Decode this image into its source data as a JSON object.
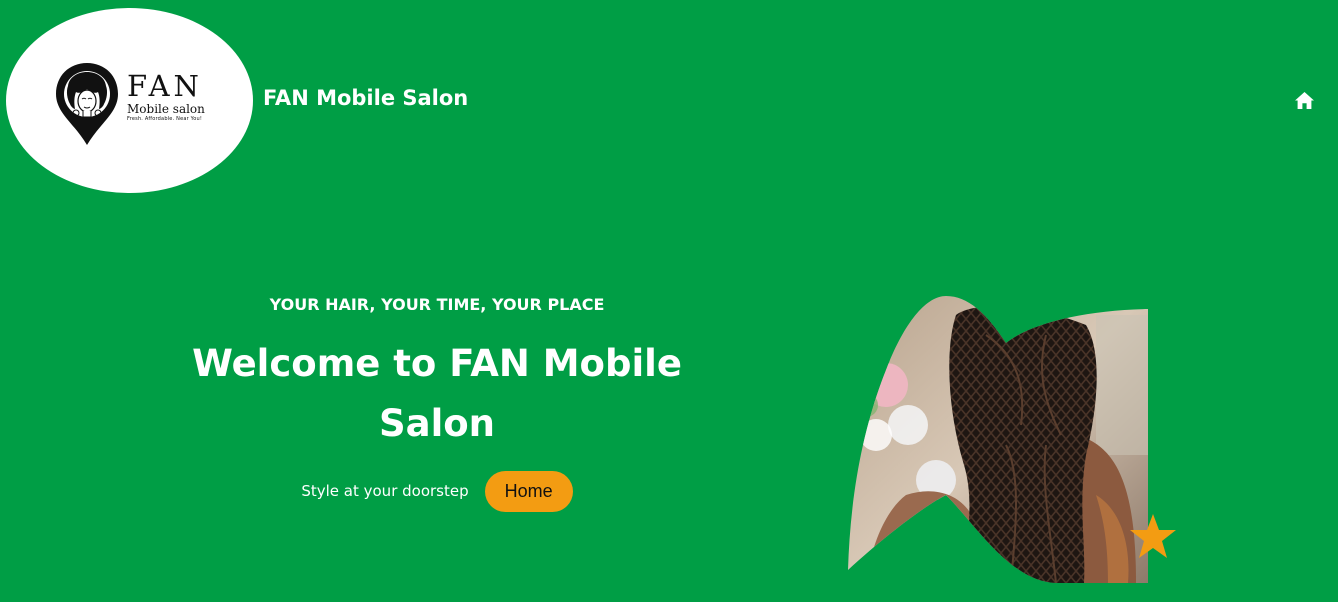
{
  "logo": {
    "icon": "afro-woman-location-pin-icon",
    "name": "FAN",
    "subtitle": "Mobile salon",
    "tagline": "Fresh. Affordable. Near You!"
  },
  "header": {
    "site_title": "FAN Mobile Salon",
    "nav_icon": "home-icon"
  },
  "hero": {
    "eyebrow": "YOUR HAIR, YOUR TIME, YOUR PLACE",
    "heading": "Welcome to FAN Mobile Salon",
    "tagline": "Style at your doorstep",
    "button_label": "Home",
    "image_alt": "braided-hair-photo",
    "decoration_icon": "star-icon"
  },
  "colors": {
    "background": "#009e45",
    "accent": "#f39c12",
    "text": "#ffffff"
  }
}
